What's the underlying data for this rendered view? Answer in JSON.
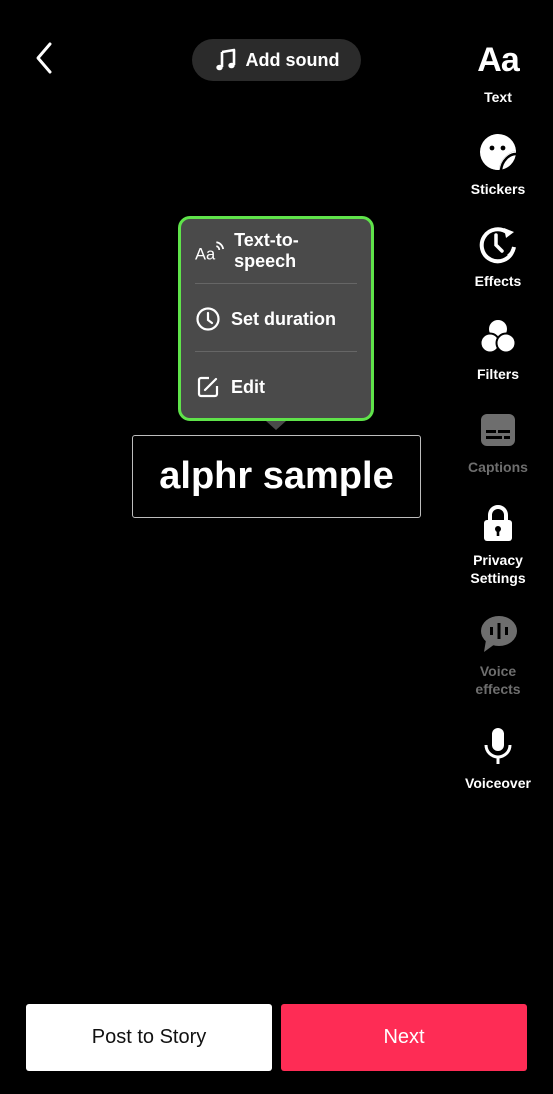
{
  "header": {
    "back_icon": "chevron-left-icon",
    "add_sound": {
      "label": "Add sound",
      "icon": "music-note-icon"
    }
  },
  "sidebar": {
    "items": [
      {
        "id": "text",
        "label": "Text",
        "icon": "text-aa-icon",
        "glyph": "Aa",
        "enabled": true
      },
      {
        "id": "stickers",
        "label": "Stickers",
        "icon": "sticker-icon",
        "enabled": true
      },
      {
        "id": "effects",
        "label": "Effects",
        "icon": "effects-timer-icon",
        "enabled": true
      },
      {
        "id": "filters",
        "label": "Filters",
        "icon": "filters-circles-icon",
        "enabled": true
      },
      {
        "id": "captions",
        "label": "Captions",
        "icon": "captions-icon",
        "enabled": false
      },
      {
        "id": "privacy",
        "label": "Privacy Settings",
        "label_line1": "Privacy",
        "label_line2": "Settings",
        "icon": "lock-icon",
        "enabled": true
      },
      {
        "id": "voice-effects",
        "label": "Voice effects",
        "label_line1": "Voice",
        "label_line2": "effects",
        "icon": "voice-effects-icon",
        "enabled": false
      },
      {
        "id": "voiceover",
        "label": "Voiceover",
        "icon": "microphone-icon",
        "enabled": true
      }
    ]
  },
  "popup_menu": {
    "items": [
      {
        "label": "Text-to-speech",
        "icon": "text-to-speech-icon",
        "glyph": "Aa"
      },
      {
        "label": "Set duration",
        "icon": "clock-icon"
      },
      {
        "label": "Edit",
        "icon": "edit-icon"
      }
    ],
    "highlight_color": "#5fe34a"
  },
  "canvas": {
    "text_overlay": "alphr sample"
  },
  "footer": {
    "post_to_story": "Post to Story",
    "next": "Next",
    "next_color": "#fe2c55"
  }
}
